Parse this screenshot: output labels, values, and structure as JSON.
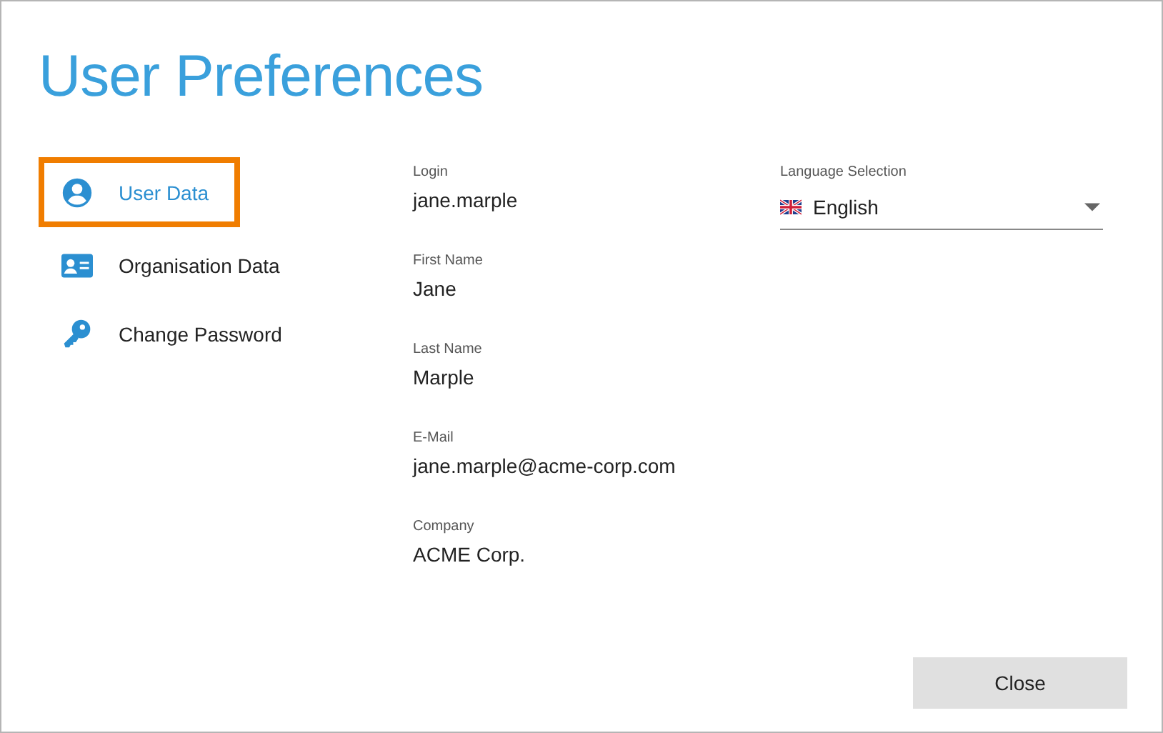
{
  "window": {
    "title": "User Preferences"
  },
  "sidebar": {
    "items": [
      {
        "kind": "user",
        "label": "User Data",
        "selected": true
      },
      {
        "kind": "card",
        "label": "Organisation Data",
        "selected": false
      },
      {
        "kind": "key",
        "label": "Change Password",
        "selected": false
      }
    ]
  },
  "fields": [
    {
      "label": "Login",
      "value": "jane.marple"
    },
    {
      "label": "First Name",
      "value": "Jane"
    },
    {
      "label": "Last Name",
      "value": "Marple"
    },
    {
      "label": "E-Mail",
      "value": "jane.marple@acme-corp.com"
    },
    {
      "label": "Company",
      "value": "ACME Corp."
    }
  ],
  "language": {
    "label": "Language Selection",
    "value": "English"
  },
  "buttons": [
    "Close"
  ]
}
